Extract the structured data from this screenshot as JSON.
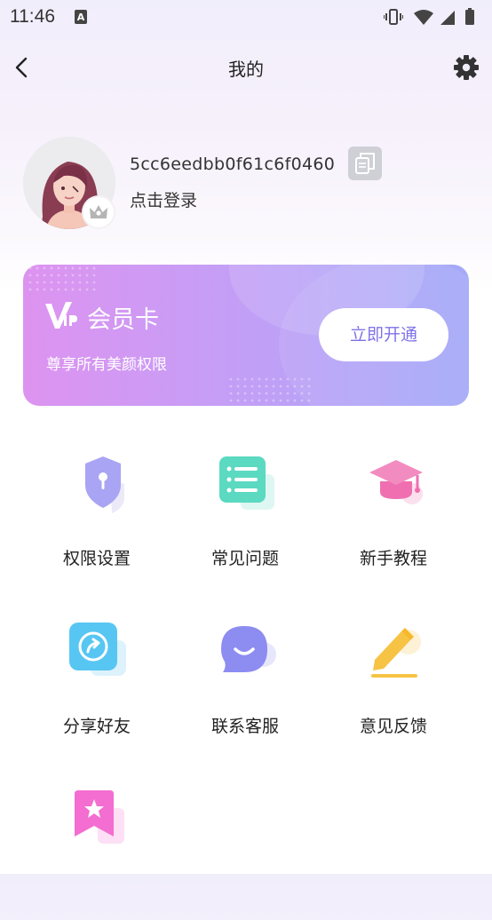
{
  "status_bar": {
    "time": "11:46"
  },
  "header": {
    "title": "我的"
  },
  "profile": {
    "user_id": "5cc6eedbb0f61c6f0460",
    "login_label": "点击登录"
  },
  "vip_card": {
    "title": "会员卡",
    "subtitle": "尊享所有美颜权限",
    "button_label": "立即开通"
  },
  "menu": [
    {
      "label": "权限设置",
      "icon": "shield-lock-icon",
      "color": "#a9a4f3"
    },
    {
      "label": "常见问题",
      "icon": "list-icon",
      "color": "#5bd9c1"
    },
    {
      "label": "新手教程",
      "icon": "graduation-cap-icon",
      "color": "#ef6fb0"
    },
    {
      "label": "分享好友",
      "icon": "share-icon",
      "color": "#58c6f2"
    },
    {
      "label": "联系客服",
      "icon": "chat-smile-icon",
      "color": "#8c8cf1"
    },
    {
      "label": "意见反馈",
      "icon": "pencil-icon",
      "color": "#f7c345"
    },
    {
      "label": "",
      "icon": "star-bookmark-icon",
      "color": "#f46dd0"
    }
  ],
  "colors": {
    "accent": "#7f73e8",
    "vip_gradient_start": "#dd93f0",
    "vip_gradient_end": "#a3a9f8"
  }
}
